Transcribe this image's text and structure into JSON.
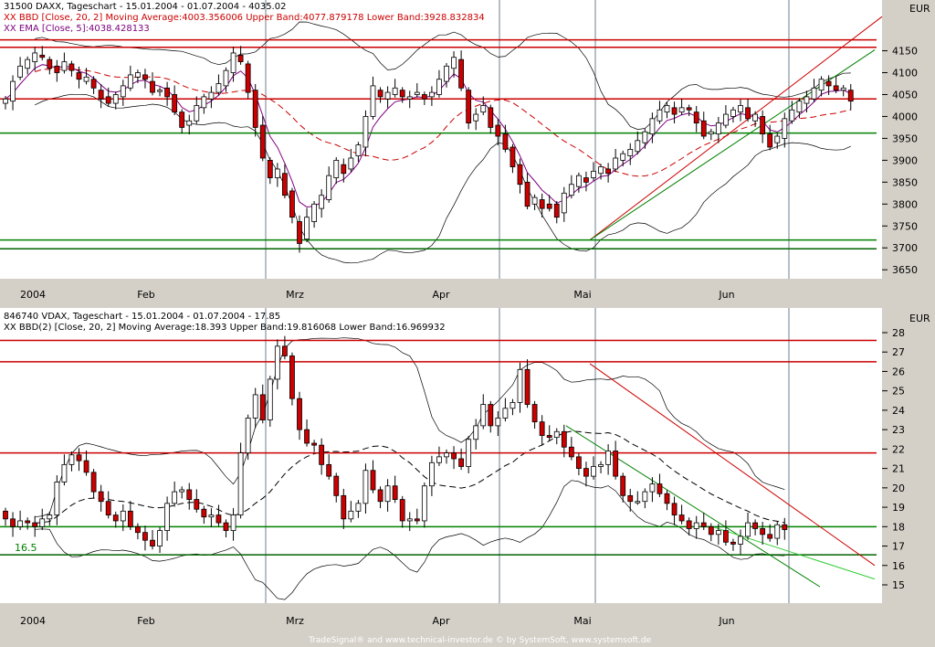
{
  "top": {
    "header": {
      "line1": "31500  DAXX, Tageschart - 15.01.2004 - 01.07.2004 - 4035.02",
      "line2": "XX BBD [Close, 20, 2] Moving Average:4003.356006 Upper Band:4077.879178 Lower Band:3928.832834",
      "line3": "XX EMA [Close, 5]:4038.428133"
    },
    "currency": "EUR",
    "yticks": [
      3650,
      3700,
      3750,
      3800,
      3850,
      3900,
      3950,
      4000,
      4050,
      4100,
      4150
    ],
    "ylim": [
      3640,
      4220
    ],
    "xlabels": [
      "2004",
      "Feb",
      "Mrz",
      "Apr",
      "Mai",
      "Jun"
    ],
    "hlines": [
      {
        "y": 4175,
        "color": "#cc0000"
      },
      {
        "y": 4158,
        "color": "#cc0000"
      },
      {
        "y": 4040,
        "color": "#cc0000"
      },
      {
        "y": 3962,
        "color": "#008000"
      },
      {
        "y": 3718,
        "color": "#008000"
      },
      {
        "y": 3698,
        "color": "#006400"
      }
    ]
  },
  "bottom": {
    "header": {
      "line1": "846740  VDAX, Tageschart - 15.01.2004 - 01.07.2004 - 17.85",
      "line2": "XX BBD(2) [Close, 20, 2] Moving Average:18.393 Upper Band:19.816068 Lower Band:16.969932"
    },
    "currency": "EUR",
    "yticks": [
      15,
      16,
      17,
      18,
      19,
      20,
      21,
      22,
      23,
      24,
      25,
      26,
      27,
      28
    ],
    "ylim": [
      14.2,
      28.8
    ],
    "level_label": "16.5",
    "xlabels": [
      "2004",
      "Feb",
      "Mrz",
      "Apr",
      "Mai",
      "Jun"
    ],
    "hlines": [
      {
        "y": 27.6,
        "color": "#cc0000"
      },
      {
        "y": 26.5,
        "color": "#cc0000"
      },
      {
        "y": 21.8,
        "color": "#cc0000"
      },
      {
        "y": 18.0,
        "color": "#008000"
      },
      {
        "y": 16.55,
        "color": "#006400"
      }
    ]
  },
  "footer": "TradeSignal® and www.technical-investor.de © by SystemSoft, www.systemsoft.de",
  "chart_data": [
    {
      "type": "candlestick",
      "title": "31500  DAXX, Tageschart - 15.01.2004 - 01.07.2004 - 4035.02",
      "ylim": [
        3640,
        4220
      ],
      "x": [
        "Jan 15",
        "Jan 16",
        "Jan 19",
        "Jan 20",
        "Jan 21",
        "Jan 22",
        "Jan 23",
        "Jan 26",
        "Jan 27",
        "Jan 28",
        "Jan 29",
        "Jan 30",
        "Feb 2",
        "Feb 3",
        "Feb 4",
        "Feb 5",
        "Feb 6",
        "Feb 9",
        "Feb 10",
        "Feb 11",
        "Feb 12",
        "Feb 13",
        "Feb 16",
        "Feb 17",
        "Feb 18",
        "Feb 19",
        "Feb 20",
        "Feb 23",
        "Feb 24",
        "Feb 25",
        "Feb 26",
        "Feb 27",
        "Mar 1",
        "Mar 2",
        "Mar 3",
        "Mar 4",
        "Mar 5",
        "Mar 8",
        "Mar 9",
        "Mar 10",
        "Mar 11",
        "Mar 12",
        "Mar 15",
        "Mar 16",
        "Mar 17",
        "Mar 18",
        "Mar 19",
        "Mar 22",
        "Mar 23",
        "Mar 24",
        "Mar 25",
        "Mar 26",
        "Mar 29",
        "Mar 30",
        "Mar 31",
        "Apr 1",
        "Apr 2",
        "Apr 5",
        "Apr 6",
        "Apr 7",
        "Apr 8",
        "Apr 13",
        "Apr 14",
        "Apr 15",
        "Apr 16",
        "Apr 19",
        "Apr 20",
        "Apr 21",
        "Apr 22",
        "Apr 23",
        "Apr 26",
        "Apr 27",
        "Apr 28",
        "Apr 29",
        "Apr 30",
        "May 3",
        "May 4",
        "May 5",
        "May 6",
        "May 7",
        "May 10",
        "May 11",
        "May 12",
        "May 13",
        "May 14",
        "May 17",
        "May 18",
        "May 19",
        "May 20",
        "May 21",
        "May 24",
        "May 25",
        "May 26",
        "May 27",
        "May 28",
        "Jun 1",
        "Jun 2",
        "Jun 3",
        "Jun 4",
        "Jun 7",
        "Jun 8",
        "Jun 9",
        "Jun 10",
        "Jun 11",
        "Jun 14",
        "Jun 15",
        "Jun 16",
        "Jun 17",
        "Jun 18",
        "Jun 21",
        "Jun 22",
        "Jun 23",
        "Jun 24",
        "Jun 25",
        "Jun 28",
        "Jun 29",
        "Jun 30",
        "Jul 1"
      ],
      "open": [
        4030,
        4035,
        4090,
        4110,
        4125,
        4140,
        4130,
        4115,
        4105,
        4120,
        4100,
        4080,
        4085,
        4060,
        4045,
        4030,
        4045,
        4065,
        4090,
        4095,
        4080,
        4060,
        4065,
        4050,
        4010,
        3980,
        3990,
        4020,
        4040,
        4055,
        4070,
        4100,
        4140,
        4120,
        4060,
        3980,
        3900,
        3860,
        3870,
        3830,
        3760,
        3720,
        3760,
        3790,
        3810,
        3860,
        3890,
        3880,
        3910,
        3930,
        4000,
        4060,
        4040,
        4050,
        4060,
        4040,
        4050,
        4050,
        4045,
        4050,
        4080,
        4110,
        4130,
        4060,
        3990,
        4010,
        4020,
        3980,
        3960,
        3930,
        3890,
        3850,
        3800,
        3810,
        3800,
        3800,
        3780,
        3820,
        3840,
        3860,
        3860,
        3870,
        3880,
        3880,
        3900,
        3910,
        3920,
        3940,
        3960,
        3990,
        4010,
        4020,
        4010,
        4020,
        4010,
        3990,
        3960,
        3960,
        3980,
        4000,
        4010,
        4020,
        3990,
        4000,
        3960,
        3940,
        3950,
        3990,
        4010,
        4030,
        4040,
        4060,
        4080,
        4070,
        4060,
        4060
      ],
      "close": [
        4040,
        4080,
        4115,
        4130,
        4145,
        4135,
        4110,
        4100,
        4125,
        4105,
        4085,
        4090,
        4065,
        4040,
        4030,
        4050,
        4070,
        4095,
        4100,
        4085,
        4055,
        4060,
        4045,
        4010,
        3975,
        3990,
        4025,
        4045,
        4055,
        4075,
        4105,
        4145,
        4125,
        4055,
        3975,
        3905,
        3860,
        3880,
        3820,
        3770,
        3710,
        3770,
        3800,
        3820,
        3865,
        3900,
        3870,
        3905,
        3935,
        4000,
        4070,
        4045,
        4055,
        4065,
        4045,
        4045,
        4055,
        4040,
        4055,
        4085,
        4115,
        4135,
        4065,
        3985,
        4005,
        4025,
        3975,
        3955,
        3925,
        3885,
        3845,
        3795,
        3815,
        3790,
        3790,
        3770,
        3825,
        3845,
        3865,
        3850,
        3875,
        3885,
        3870,
        3905,
        3915,
        3925,
        3945,
        3965,
        3995,
        4015,
        4025,
        4005,
        4020,
        4015,
        3985,
        3955,
        3965,
        3985,
        4005,
        4015,
        4025,
        3995,
        4005,
        3960,
        3930,
        3955,
        3995,
        4015,
        4035,
        4045,
        4065,
        4085,
        4070,
        4060,
        4065,
        4035
      ]
    },
    {
      "type": "candlestick",
      "title": "846740  VDAX, Tageschart - 15.01.2004 - 01.07.2004 - 17.85",
      "ylim": [
        14.2,
        28.8
      ],
      "x": [
        "Jan 15",
        "Jan 16",
        "Jan 19",
        "Jan 20",
        "Jan 21",
        "Jan 22",
        "Jan 23",
        "Jan 26",
        "Jan 27",
        "Jan 28",
        "Jan 29",
        "Jan 30",
        "Feb 2",
        "Feb 3",
        "Feb 4",
        "Feb 5",
        "Feb 6",
        "Feb 9",
        "Feb 10",
        "Feb 11",
        "Feb 12",
        "Feb 13",
        "Feb 16",
        "Feb 17",
        "Feb 18",
        "Feb 19",
        "Feb 20",
        "Feb 23",
        "Feb 24",
        "Feb 25",
        "Feb 26",
        "Feb 27",
        "Mar 1",
        "Mar 2",
        "Mar 3",
        "Mar 4",
        "Mar 5",
        "Mar 8",
        "Mar 9",
        "Mar 10",
        "Mar 11",
        "Mar 12",
        "Mar 15",
        "Mar 16",
        "Mar 17",
        "Mar 18",
        "Mar 19",
        "Mar 22",
        "Mar 23",
        "Mar 24",
        "Mar 25",
        "Mar 26",
        "Mar 29",
        "Mar 30",
        "Mar 31",
        "Apr 1",
        "Apr 2",
        "Apr 5",
        "Apr 6",
        "Apr 7",
        "Apr 8",
        "Apr 13",
        "Apr 14",
        "Apr 15",
        "Apr 16",
        "Apr 19",
        "Apr 20",
        "Apr 21",
        "Apr 22",
        "Apr 23",
        "Apr 26",
        "Apr 27",
        "Apr 28",
        "Apr 29",
        "Apr 30",
        "May 3",
        "May 4",
        "May 5",
        "May 6",
        "May 7",
        "May 10",
        "May 11",
        "May 12",
        "May 13",
        "May 14",
        "May 17",
        "May 18",
        "May 19",
        "May 20",
        "May 21",
        "May 24",
        "May 25",
        "May 26",
        "May 27",
        "May 28",
        "Jun 1",
        "Jun 2",
        "Jun 3",
        "Jun 4",
        "Jun 7",
        "Jun 8",
        "Jun 9",
        "Jun 10",
        "Jun 11",
        "Jun 14",
        "Jun 15",
        "Jun 16",
        "Jun 17",
        "Jun 18",
        "Jun 21",
        "Jun 22",
        "Jun 23",
        "Jun 24",
        "Jun 25",
        "Jun 28",
        "Jun 29",
        "Jun 30",
        "Jul 1"
      ],
      "open": [
        18.8,
        18.4,
        18.0,
        18.3,
        18.2,
        18.0,
        18.4,
        18.6,
        20.3,
        21.2,
        21.7,
        21.4,
        20.8,
        19.8,
        19.3,
        18.6,
        18.3,
        18.8,
        18.0,
        17.7,
        17.3,
        17.0,
        17.8,
        19.2,
        19.8,
        19.9,
        19.4,
        18.9,
        18.5,
        18.6,
        18.2,
        17.8,
        18.6,
        21.8,
        23.6,
        24.8,
        23.5,
        25.6,
        27.3,
        26.8,
        24.6,
        23.0,
        22.3,
        22.2,
        21.2,
        20.6,
        19.6,
        18.4,
        18.8,
        19.2,
        20.9,
        19.9,
        19.3,
        20.1,
        19.4,
        18.3,
        18.4,
        18.3,
        20.1,
        21.3,
        21.6,
        21.8,
        21.5,
        21.1,
        22.5,
        23.2,
        24.3,
        23.2,
        23.6,
        24.1,
        24.4,
        26.1,
        24.3,
        23.4,
        22.7,
        22.6,
        22.9,
        22.1,
        21.6,
        21.0,
        20.6,
        21.1,
        21.2,
        21.9,
        20.6,
        19.6,
        19.3,
        19.3,
        19.8,
        20.2,
        19.7,
        19.2,
        18.6,
        18.3,
        17.9,
        18.2,
        18.0,
        17.6,
        17.8,
        17.2,
        17.1,
        17.5,
        18.2,
        17.9,
        17.6,
        17.4,
        18.1
      ],
      "close": [
        18.4,
        18.0,
        18.3,
        18.2,
        18.0,
        18.4,
        18.6,
        20.3,
        21.2,
        21.7,
        21.4,
        20.8,
        19.8,
        19.3,
        18.6,
        18.3,
        18.8,
        18.0,
        17.7,
        17.3,
        17.0,
        17.8,
        19.2,
        19.8,
        19.9,
        19.4,
        18.9,
        18.5,
        18.6,
        18.2,
        17.8,
        18.6,
        21.8,
        23.6,
        24.8,
        23.5,
        25.6,
        27.3,
        26.8,
        24.6,
        23.0,
        22.3,
        22.2,
        21.2,
        20.6,
        19.6,
        18.4,
        18.8,
        19.2,
        20.9,
        19.9,
        19.3,
        20.1,
        19.4,
        18.3,
        18.4,
        18.3,
        20.1,
        21.3,
        21.6,
        21.8,
        21.5,
        21.1,
        22.5,
        23.2,
        24.3,
        23.2,
        23.6,
        24.1,
        24.4,
        26.1,
        24.3,
        23.4,
        22.7,
        22.6,
        22.9,
        22.1,
        21.6,
        21.0,
        20.6,
        21.1,
        21.2,
        21.9,
        20.6,
        19.6,
        19.3,
        19.3,
        19.8,
        20.2,
        19.7,
        19.2,
        18.6,
        18.3,
        17.9,
        18.2,
        18.0,
        17.6,
        17.8,
        17.2,
        17.1,
        17.5,
        18.2,
        17.9,
        17.6,
        17.4,
        18.1,
        17.85
      ]
    }
  ]
}
